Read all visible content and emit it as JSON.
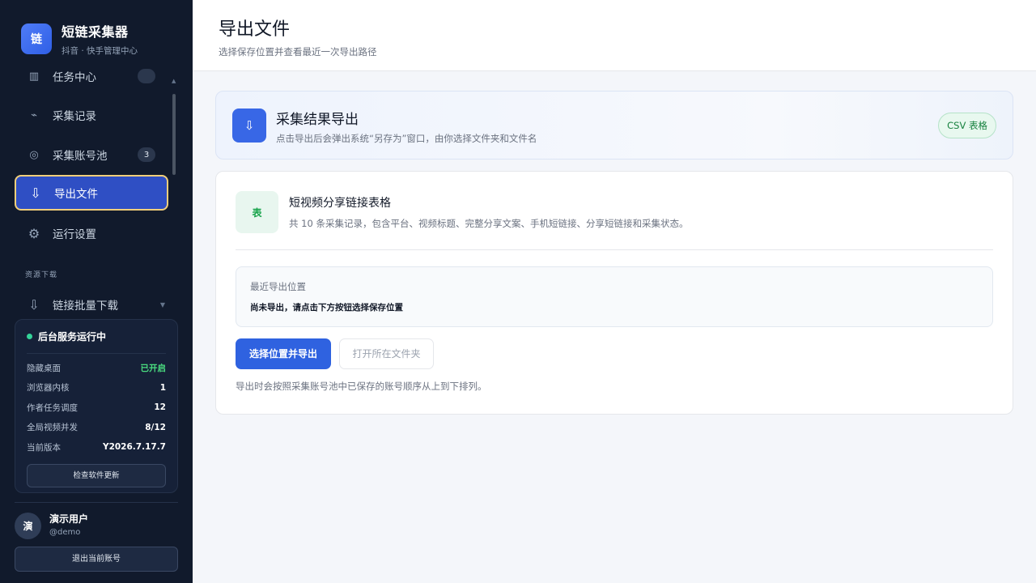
{
  "brand": {
    "logo": "链",
    "title": "短链采集器",
    "subtitle": "抖音 · 快手管理中心"
  },
  "nav": {
    "partial_item": {
      "label": "任务中心",
      "icon": "chart-icon"
    },
    "items": [
      {
        "label": "采集记录",
        "icon": "pulse-icon"
      },
      {
        "label": "采集账号池",
        "icon": "target-icon",
        "badge": "3"
      },
      {
        "label": "导出文件",
        "icon": "download-icon",
        "active": true
      },
      {
        "label": "运行设置",
        "icon": "gear-icon"
      }
    ],
    "section_label": "资源下载",
    "download_item": {
      "label": "链接批量下载",
      "icon": "download-icon"
    }
  },
  "status": {
    "title": "后台服务运行中",
    "rows": [
      {
        "label": "隐藏桌面",
        "value": "已开启"
      },
      {
        "label": "浏览器内核",
        "value": "1"
      },
      {
        "label": "作者任务调度",
        "value": "12"
      },
      {
        "label": "全局视频并发",
        "value": "8/12"
      },
      {
        "label": "当前版本",
        "value": "Y2026.7.17.7"
      }
    ],
    "check_update_label": "检查软件更新"
  },
  "user": {
    "avatar": "演",
    "name": "演示用户",
    "handle": "@demo",
    "logout_label": "退出当前账号"
  },
  "header": {
    "title": "导出文件",
    "subtitle": "选择保存位置并查看最近一次导出路径"
  },
  "hero": {
    "icon": "⇩",
    "title": "采集结果导出",
    "subtitle": "点击导出后会弹出系统“另存为”窗口，由你选择文件夹和文件名",
    "badge": "CSV 表格"
  },
  "file": {
    "icon": "表",
    "title": "短视频分享链接表格",
    "desc": "共 10 条采集记录，包含平台、视频标题、完整分享文案、手机短链接、分享短链接和采集状态。"
  },
  "location": {
    "label": "最近导出位置",
    "value": "尚未导出，请点击下方按钮选择保存位置"
  },
  "actions": {
    "primary": "选择位置并导出",
    "secondary": "打开所在文件夹"
  },
  "note": "导出时会按照采集账号池中已保存的账号顺序从上到下排列。",
  "colors": {
    "accent": "#2f62e0",
    "sidebar_bg": "#111a2c",
    "active_border": "#f2cf7a",
    "success": "#4ade80"
  }
}
